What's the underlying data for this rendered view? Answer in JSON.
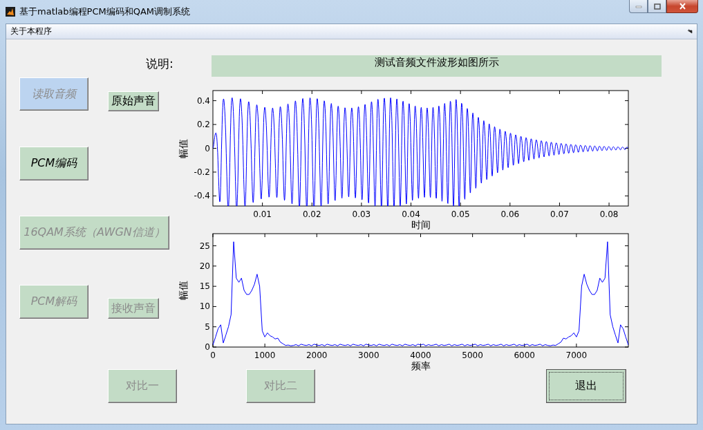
{
  "window": {
    "title": "基于matlab编程PCM编码和QAM调制系统"
  },
  "menu": [
    {
      "label": "关于本程序"
    }
  ],
  "description": {
    "label": "说明:",
    "text": "测试音频文件波形如图所示"
  },
  "buttons": [
    {
      "label": "读取音频",
      "disabled": true,
      "highlighted": true,
      "focused": false
    },
    {
      "label": "原始声音",
      "disabled": false,
      "highlighted": false,
      "focused": false
    },
    {
      "label": "PCM编码",
      "disabled": false,
      "highlighted": false,
      "focused": false
    },
    {
      "label": "16QAM系统（AWGN信道）",
      "disabled": true,
      "highlighted": false,
      "focused": false
    },
    {
      "label": "PCM解码",
      "disabled": true,
      "highlighted": false,
      "focused": false
    },
    {
      "label": "接收声音",
      "disabled": true,
      "highlighted": false,
      "focused": false
    },
    {
      "label": "对比一",
      "disabled": true,
      "highlighted": false,
      "focused": false
    },
    {
      "label": "对比二",
      "disabled": true,
      "highlighted": false,
      "focused": false
    },
    {
      "label": "退出",
      "disabled": false,
      "highlighted": false,
      "focused": true
    }
  ],
  "plots": [
    {
      "kind": "waveform",
      "ylabel": "幅值",
      "xlabel": "时间",
      "yticks": [
        "0.4",
        "0.2",
        "0",
        "-0.2",
        "-0.4"
      ],
      "xticks": [
        "0.01",
        "0.02",
        "0.03",
        "0.04",
        "0.05",
        "0.06",
        "0.07",
        "0.08"
      ]
    },
    {
      "kind": "spectrum",
      "chart_data": {
        "type": "line",
        "xlabel": "频率",
        "ylabel": "幅值",
        "x": [
          0,
          50,
          100,
          150,
          200,
          250,
          300,
          350,
          400,
          450,
          500,
          550,
          600,
          650,
          700,
          750,
          800,
          850,
          900,
          950,
          1000,
          1050,
          1100,
          1150,
          1200,
          1250,
          1300,
          1350,
          1400,
          1450,
          1500,
          1550,
          1600,
          1650,
          1700,
          1750,
          1800,
          1850,
          1900,
          1950,
          2000,
          2050,
          2100,
          2150,
          2200,
          2250,
          2300,
          2350,
          2400,
          2450,
          2500,
          2550,
          2600,
          2650,
          2700,
          2750,
          2800,
          2850,
          2900,
          2950,
          3000,
          3050,
          3100,
          3150,
          3200,
          3250,
          3300,
          3350,
          3400,
          3450,
          3500,
          3550,
          3600,
          3650,
          3700,
          3750,
          3800,
          3850,
          3900,
          3950,
          4000,
          4050,
          4100,
          4150,
          4200,
          4250,
          4300,
          4350,
          4400,
          4450,
          4500,
          4550,
          4600,
          4650,
          4700,
          4750,
          4800,
          4850,
          4900,
          4950,
          5000,
          5050,
          5100,
          5150,
          5200,
          5250,
          5300,
          5350,
          5400,
          5450,
          5500,
          5550,
          5600,
          5650,
          5700,
          5750,
          5800,
          5850,
          5900,
          5950,
          6000,
          6050,
          6100,
          6150,
          6200,
          6250,
          6300,
          6350,
          6400,
          6450,
          6500,
          6550,
          6600,
          6650,
          6700,
          6750,
          6800,
          6850,
          6900,
          6950,
          7000,
          7050,
          7100,
          7150,
          7200,
          7250,
          7300,
          7350,
          7400,
          7450,
          7500,
          7550,
          7600,
          7650,
          7700,
          7750,
          7800,
          7850,
          7900,
          7950,
          8000
        ],
        "series": [
          {
            "color": "#0000ff",
            "values": [
              0.5,
              2.5,
              4.5,
              5.5,
              1,
              3,
              5,
              8,
              26,
              17,
              16,
              17,
              14,
              13,
              13,
              14,
              15.5,
              18,
              15,
              4,
              2.5,
              3.5,
              2.8,
              2.5,
              2,
              2.2,
              1.2,
              0.8,
              0.4,
              0.5,
              0.3,
              0.4,
              0.6,
              0.3,
              0.7,
              0.5,
              0.4,
              0.6,
              0.3,
              0.7,
              0.5,
              0.4,
              0.6,
              0.3,
              0.7,
              0.5,
              0.4,
              0.6,
              0.3,
              0.7,
              0.5,
              0.4,
              0.6,
              0.3,
              0.7,
              0.5,
              0.4,
              0.6,
              0.3,
              0.7,
              0.5,
              0.4,
              0.6,
              0.3,
              0.7,
              0.5,
              0.4,
              0.6,
              0.3,
              0.7,
              0.5,
              0.4,
              0.6,
              0.3,
              0.7,
              0.5,
              0.4,
              0.6,
              0.3,
              0.7,
              0.5,
              0.7,
              0.3,
              0.6,
              0.4,
              0.5,
              0.7,
              0.3,
              0.6,
              0.4,
              0.5,
              0.7,
              0.3,
              0.6,
              0.4,
              0.5,
              0.7,
              0.3,
              0.6,
              0.4,
              0.5,
              0.7,
              0.3,
              0.6,
              0.4,
              0.5,
              0.7,
              0.3,
              0.6,
              0.4,
              0.5,
              0.7,
              0.3,
              0.6,
              0.4,
              0.5,
              0.7,
              0.3,
              0.6,
              0.4,
              0.5,
              0.7,
              0.3,
              0.6,
              0.4,
              0.5,
              0.7,
              0.3,
              0.6,
              0.4,
              0.3,
              0.5,
              0.4,
              0.8,
              1.2,
              2.2,
              2,
              2.5,
              2.8,
              3.5,
              2.5,
              4,
              15,
              18,
              15.5,
              14,
              13,
              13,
              14,
              17,
              16,
              17,
              26,
              8,
              5,
              3,
              1,
              5.5,
              4.5,
              2.5,
              0.5
            ]
          }
        ],
        "xlim": [
          0,
          8000
        ],
        "ylim": [
          0,
          28
        ],
        "xticks": [
          0,
          1000,
          2000,
          3000,
          4000,
          5000,
          6000,
          7000
        ],
        "yticks": [
          25,
          20,
          15,
          10,
          5,
          0
        ]
      }
    }
  ]
}
